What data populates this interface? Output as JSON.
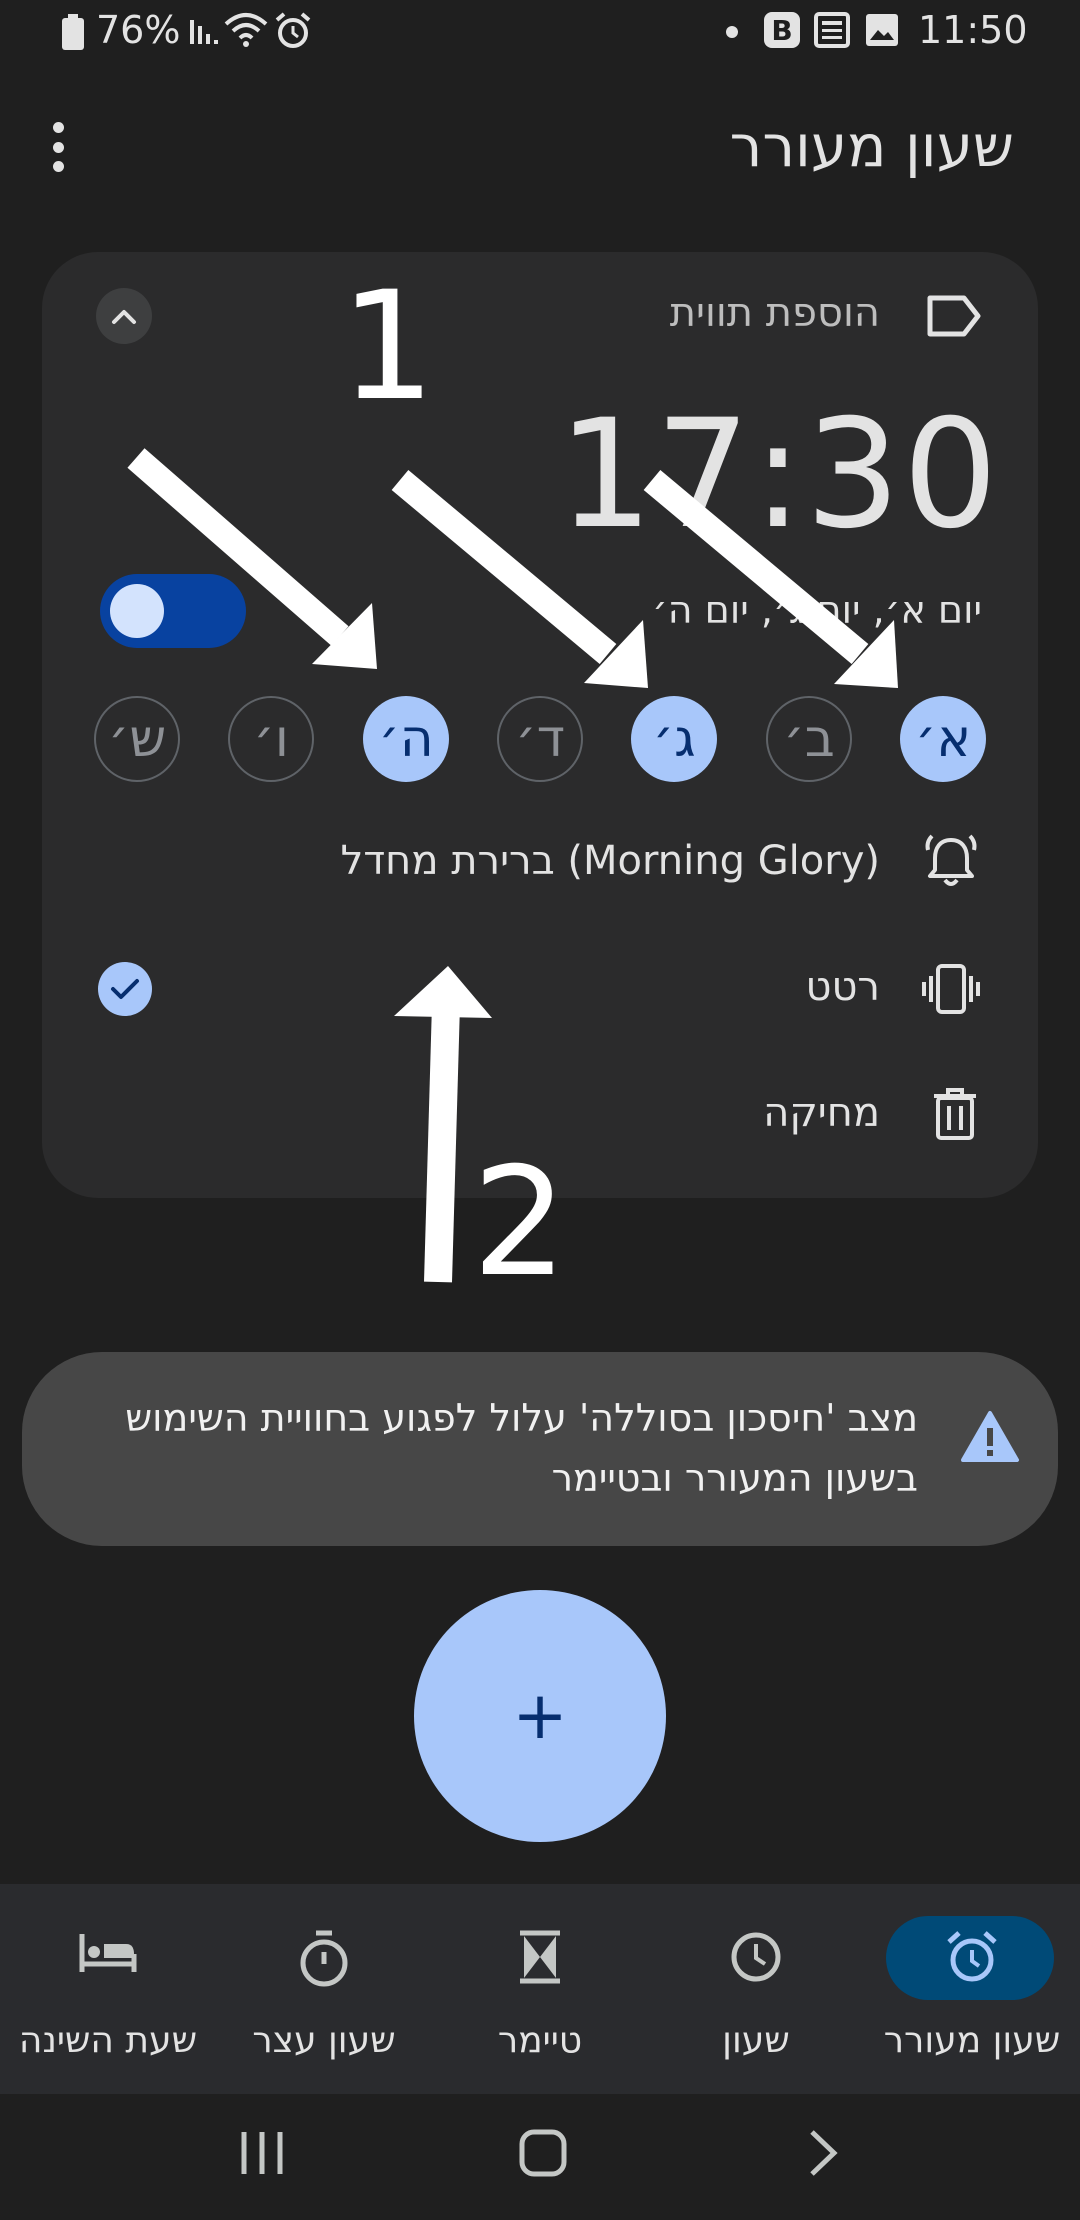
{
  "status_bar": {
    "battery": "76%",
    "time": "11:50"
  },
  "header": {
    "title": "שעון מעורר"
  },
  "alarm": {
    "label_placeholder": "הוספת תווית",
    "time": "17:30",
    "days_summary": "יום א׳, יום ג׳, יום ה׳",
    "enabled": true,
    "days": [
      {
        "label": "א׳",
        "selected": true
      },
      {
        "label": "ב׳",
        "selected": false
      },
      {
        "label": "ג׳",
        "selected": true
      },
      {
        "label": "ד׳",
        "selected": false
      },
      {
        "label": "ה׳",
        "selected": true
      },
      {
        "label": "ו׳",
        "selected": false
      },
      {
        "label": "ש׳",
        "selected": false
      }
    ],
    "ringtone": "ברירת מחדל (Morning Glory)",
    "vibrate_label": "רטט",
    "vibrate_enabled": true,
    "delete_label": "מחיקה"
  },
  "annotations": {
    "marker_1": "1",
    "marker_2": "2"
  },
  "banner": {
    "message": "מצב 'חיסכון בסוללה' עלול לפגוע בחוויית השימוש בשעון המעורר ובטיימר"
  },
  "fab": {
    "label": "+"
  },
  "bottom_nav": {
    "items": [
      {
        "label": "שעון מעורר",
        "icon": "alarm-icon",
        "active": true
      },
      {
        "label": "שעון",
        "icon": "clock-icon",
        "active": false
      },
      {
        "label": "טיימר",
        "icon": "hourglass-icon",
        "active": false
      },
      {
        "label": "שעון עצר",
        "icon": "stopwatch-icon",
        "active": false
      },
      {
        "label": "שעת השינה",
        "icon": "bed-icon",
        "active": false
      }
    ]
  },
  "colors": {
    "accent": "#a8c7fa",
    "toggle_track": "#0842a0",
    "background": "#1f1f1f",
    "card": "#2b2b2c"
  }
}
